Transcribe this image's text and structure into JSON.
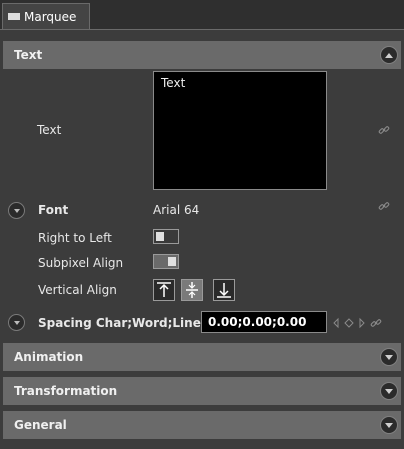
{
  "window": {
    "tab_label": "Marquee"
  },
  "sections": [
    {
      "title": "Text",
      "state": "expanded"
    },
    {
      "title": "Animation",
      "state": "collapsed"
    },
    {
      "title": "Transformation",
      "state": "collapsed"
    },
    {
      "title": "General",
      "state": "collapsed"
    }
  ],
  "text_section": {
    "text_label": "Text",
    "text_value": "Text",
    "font_label": "Font",
    "font_value": "Arial 64",
    "rtl_label": "Right to Left",
    "rtl_on": false,
    "subpixel_label": "Subpixel Align",
    "subpixel_on": true,
    "valign_label": "Vertical Align",
    "valign_options": [
      "align-top-icon",
      "align-center-icon",
      "align-bottom-icon"
    ],
    "valign_selected": "align-center-icon",
    "spacing_label": "Spacing Char;Word;Line",
    "spacing_value": "0.00;0.00;0.00"
  },
  "colors": {
    "background": "#3c3c3c",
    "section_header": "#6a6a6a",
    "input_background": "#000000"
  }
}
